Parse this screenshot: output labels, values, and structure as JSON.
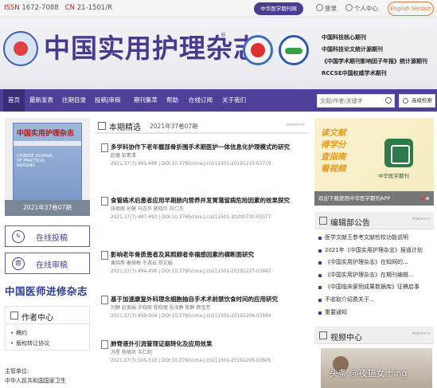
{
  "topbar": {
    "issn_label": "ISSN",
    "issn_value": "1672-7088",
    "cn_label": "CN",
    "cn_value": "21-1501/R",
    "app_button": "中华医学期刊网",
    "login": "登录",
    "personal_center": "个人中心",
    "english_version": "English Version"
  },
  "header": {
    "journal_title": "中国实用护理杂志",
    "registered_mark": "®",
    "honors": [
      "中国科技核心期刊",
      "中国科技论文统计源期刊",
      "《中国学术期刊影响因子年报》统计源期刊",
      "RCCSE中国权威学术期刊"
    ]
  },
  "nav": {
    "items": [
      "首页",
      "最新发表",
      "往期目录",
      "投稿|审稿",
      "期刊集萃",
      "帮助",
      "在线订阅",
      "关于我们"
    ],
    "search_placeholder": "文题/作者/关键字",
    "advanced_search": "高级检索"
  },
  "sidebar": {
    "cover": {
      "title": "中国实用护理杂志",
      "en_title": "CHINESE JOURNAL OF PRACTICAL NURSING",
      "caption": "2021年37卷07期"
    },
    "online_submit": "在线投稿",
    "online_review": "在线审稿",
    "promo_logo": "中国医师进修杂志",
    "author_center": {
      "title": "作者中心",
      "links": [
        "稿约",
        "版权转让协议"
      ]
    },
    "sponsor_label": "主管单位:",
    "sponsor_value": "中华人民共和国国家卫生"
  },
  "main": {
    "section_title": "本期精选",
    "issue": "2021年37卷07期",
    "more": "more>>",
    "articles": [
      {
        "title": "多学科协作下老年髋部骨折围手术期医护一体信息化护理模式的研究",
        "authors": "赵璐 彭素清",
        "meta": "2021,37(7):481-486 | DOI:10.3760/cma.j.cn211501-20191215-03719"
      },
      {
        "title": "食管癌术后患者应用早期肠内营养并发胃潴留病危险因素的效果探究",
        "authors": "张丽丽 孙健 马志华 郭晓玲 刘仁杰",
        "meta": "2021,37(7):487-493 | DOI:10.3760/cma.j.cn211501-20200730-03377"
      },
      {
        "title": "影响老年骨质患者及其照顾者幸福感因素的横断面研究",
        "authors": "黄晓燕 秦丽梅 于淑云 郑文娟",
        "meta": "2021,37(7):494-498 | DOI:10.3760/cma.j.cn211501-20191227-03842"
      },
      {
        "title": "基于加速康复外科理念细胞抽自手术术前禁饮食时间的应用研究",
        "authors": "刘静 赵美娟 许晓丽 程晓丽 张海静 陈静 颜宝芳",
        "meta": "2021,37(7):499-504 | DOI:10.3760/cma.j.cn211501-20191204-03594"
      },
      {
        "title": "肺脊液外引流管理证据转化及应用效果",
        "authors": "冯星 杨丽凤 韦仁利",
        "meta": "2021,37(7):505-510 | DOI:10.3760/cma.j.cn211501-20191205-03605"
      }
    ]
  },
  "right": {
    "slogan": [
      "读文献",
      "得学分",
      "查指南",
      "看视频"
    ],
    "app_name": "中华医学期刊",
    "app_caption": "欢迎下载使用中华医学期刊APP",
    "notice_title": "编辑部公告",
    "more": "more>>",
    "notices": [
      "医学文献王参考文献检校功能说明",
      "2021年《中国实用护理杂志》报道计划",
      "《中国实用护理杂志》在知网的...",
      "《中国实用护理杂志》在期刊编辑...",
      "《中国临床案例成果数据库》征稿启事",
      "不收取介绍费关于...",
      "重要通知"
    ],
    "video_title": "视频中心"
  },
  "watermark": "头条 @夜猫女士ing",
  "colors": {
    "brand": "#503f98",
    "accent": "#e07a3a"
  }
}
